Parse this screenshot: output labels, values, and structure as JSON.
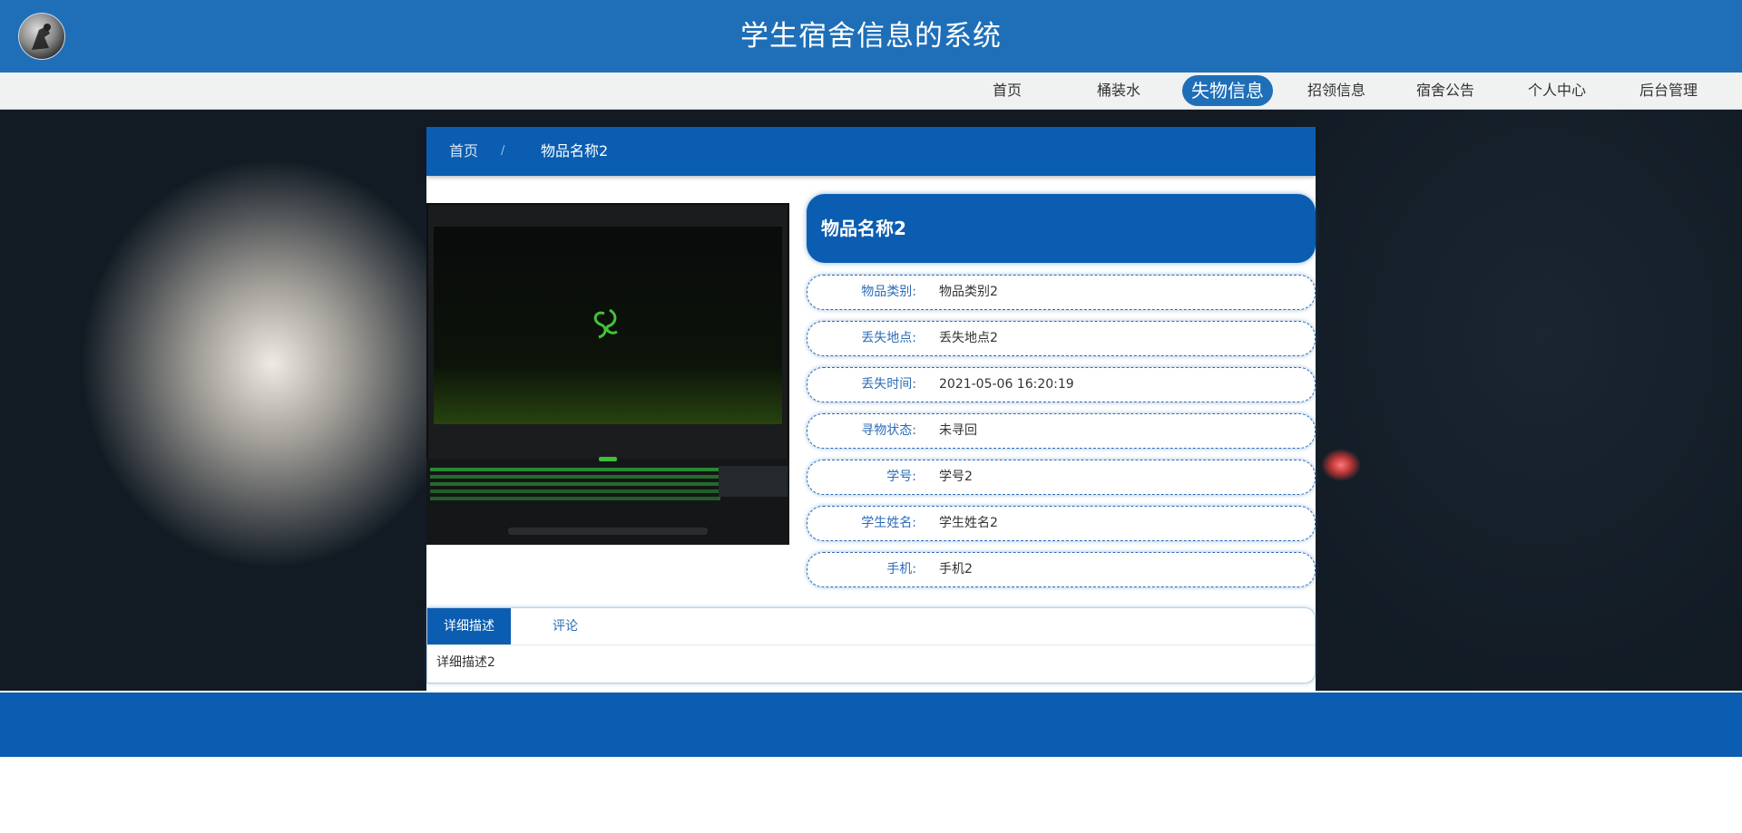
{
  "header": {
    "title": "学生宿舍信息的系统"
  },
  "nav": {
    "items": [
      "首页",
      "桶装水",
      "失物信息",
      "招领信息",
      "宿舍公告",
      "个人中心",
      "后台管理"
    ],
    "active": "失物信息"
  },
  "breadcrumb": {
    "home": "首页",
    "separator": "/",
    "current": "物品名称2"
  },
  "detail": {
    "title": "物品名称2",
    "fields": [
      {
        "label": "物品类别:",
        "value": "物品类别2"
      },
      {
        "label": "丢失地点:",
        "value": "丢失地点2"
      },
      {
        "label": "丢失时间:",
        "value": "2021-05-06 16:20:19"
      },
      {
        "label": "寻物状态:",
        "value": "未寻回"
      },
      {
        "label": "学号:",
        "value": "学号2"
      },
      {
        "label": "学生姓名:",
        "value": "学生姓名2"
      },
      {
        "label": "手机:",
        "value": "手机2"
      }
    ]
  },
  "tabs": {
    "items": [
      "详细描述",
      "评论"
    ],
    "active": "详细描述",
    "content": "详细描述2"
  },
  "colors": {
    "primary": "#0a5db0",
    "header": "#1f6fb8",
    "nav_bg": "#f0f1f1",
    "label": "#2b6db7"
  },
  "icons": {
    "logo": "logo-icon",
    "product": "laptop-image"
  }
}
